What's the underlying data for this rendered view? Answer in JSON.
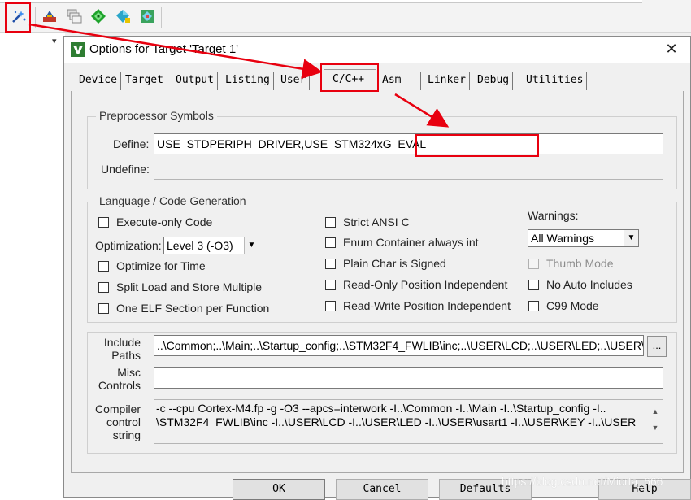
{
  "toolbar": {
    "icons": [
      "magic-wand-icon",
      "build-icon",
      "windows-icon",
      "pack-icon",
      "diamond-icon",
      "multi-project-icon"
    ]
  },
  "dialog": {
    "title": "Options for Target 'Target 1'",
    "close_glyph": "✕",
    "tabs": [
      "Device",
      "Target",
      "Output",
      "Listing",
      "User",
      "C/C++",
      "Asm",
      "Linker",
      "Debug",
      "Utilities"
    ],
    "active_tab": "C/C++"
  },
  "preprocessor": {
    "title": "Preprocessor Symbols",
    "define_label": "Define:",
    "define_value": "USE_STDPERIPH_DRIVER,USE_STM324xG_EVAL",
    "undefine_label": "Undefine:",
    "undefine_value": ""
  },
  "language": {
    "title": "Language / Code Generation",
    "execute_only": "Execute-only Code",
    "optimization_label": "Optimization:",
    "optimization_value": "Level 3 (-O3)",
    "optimize_time": "Optimize for Time",
    "split_load": "Split Load and Store Multiple",
    "one_elf": "One ELF Section per Function",
    "strict_ansi": "Strict ANSI C",
    "enum_container": "Enum Container always int",
    "plain_char": "Plain Char is Signed",
    "ro_pi": "Read-Only Position Independent",
    "rw_pi": "Read-Write Position Independent",
    "warnings_label": "Warnings:",
    "warnings_value": "All Warnings",
    "thumb_mode": "Thumb Mode",
    "no_auto_includes": "No Auto Includes",
    "c99_mode": "C99 Mode"
  },
  "include": {
    "include_label_1": "Include",
    "include_label_2": "Paths",
    "include_value": "..\\Common;..\\Main;..\\Startup_config;..\\STM32F4_FWLIB\\inc;..\\USER\\LCD;..\\USER\\LED;..\\USER\\",
    "browse": "...",
    "misc_label_1": "Misc",
    "misc_label_2": "Controls",
    "misc_value": "",
    "compiler_label_1": "Compiler",
    "compiler_label_2": "control",
    "compiler_label_3": "string",
    "compiler_line_1": "-c --cpu Cortex-M4.fp -g -O3 --apcs=interwork -I..\\Common -I..\\Main -I..\\Startup_config -I..",
    "compiler_line_2": "\\STM32F4_FWLIB\\inc -I..\\USER\\LCD -I..\\USER\\LED -I..\\USER\\usart1 -I..\\USER\\KEY -I..\\USER"
  },
  "buttons": {
    "ok": "OK",
    "cancel": "Cancel",
    "defaults": "Defaults",
    "help": "Help"
  },
  "watermark": "https://blog.csdn.net/Micrta_666",
  "colors": {
    "annotation_red": "#e8000f",
    "dialog_bg": "#f0f0f0"
  }
}
